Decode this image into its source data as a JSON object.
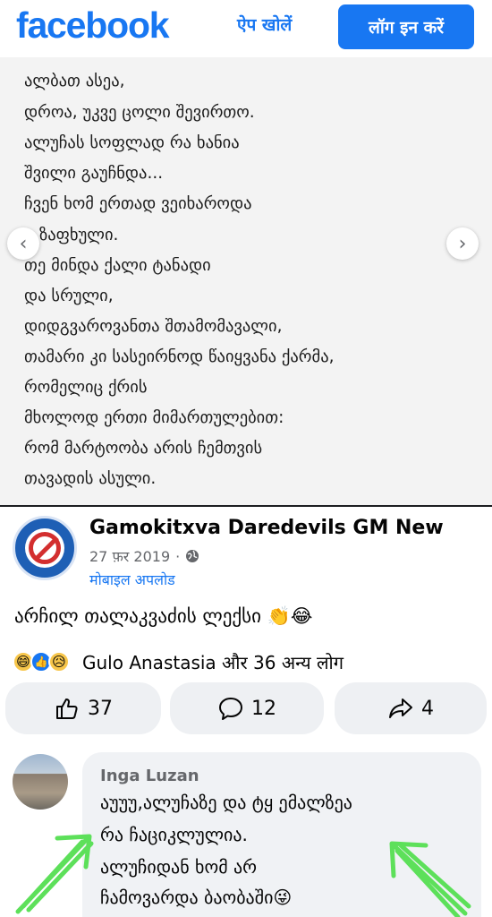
{
  "header": {
    "logo": "facebook",
    "open_app": "ऐप खोलें",
    "login": "लॉग इन करें"
  },
  "post_image": {
    "poem_lines": [
      "ალბათ ასეა,",
      "დროა, უკვე ცოლი შევირთო.",
      "ალუჩას სოფლად რა ხანია",
      "შვილი გაუჩნდა...",
      "ჩვენ ხომ ერთად ვეიხაროდა",
      "ზაფხული.",
      "თე მინდა ქალი ტანადი",
      "და სრული,",
      "დიდგვაროვანთა შთამომავალი,",
      "თამარი კი სასეირნოდ წაიყვანა ქარმა,",
      "რომელიც ქრის",
      "მხოლოდ ერთი მიმართულებით:",
      "რომ მარტოობა არის ჩემთვის",
      "თავადის ასული."
    ]
  },
  "post": {
    "page_name": "Gamokitxva Daredevils GM New",
    "date": "27 फ़र 2019",
    "dot": "·",
    "upload": "मोबाइल अपलोड",
    "caption": "არჩილ თალაკვაძის ლექსი 👏😂",
    "reactions_text": "Gulo Anastasia और 36 अन्य लोग",
    "like_count": "37",
    "comment_count": "12",
    "share_count": "4"
  },
  "comment": {
    "author": "Inga Luzan",
    "lines": [
      "აუუუ,ალუჩაზე და ტყ ემალზეა",
      "რა ჩაციკლულია.",
      "ალუჩიდან ხომ არ",
      "ჩამოვარდა ბაობაში😜"
    ]
  },
  "colors": {
    "brand": "#1877f2",
    "annotation": "#5de05a"
  }
}
